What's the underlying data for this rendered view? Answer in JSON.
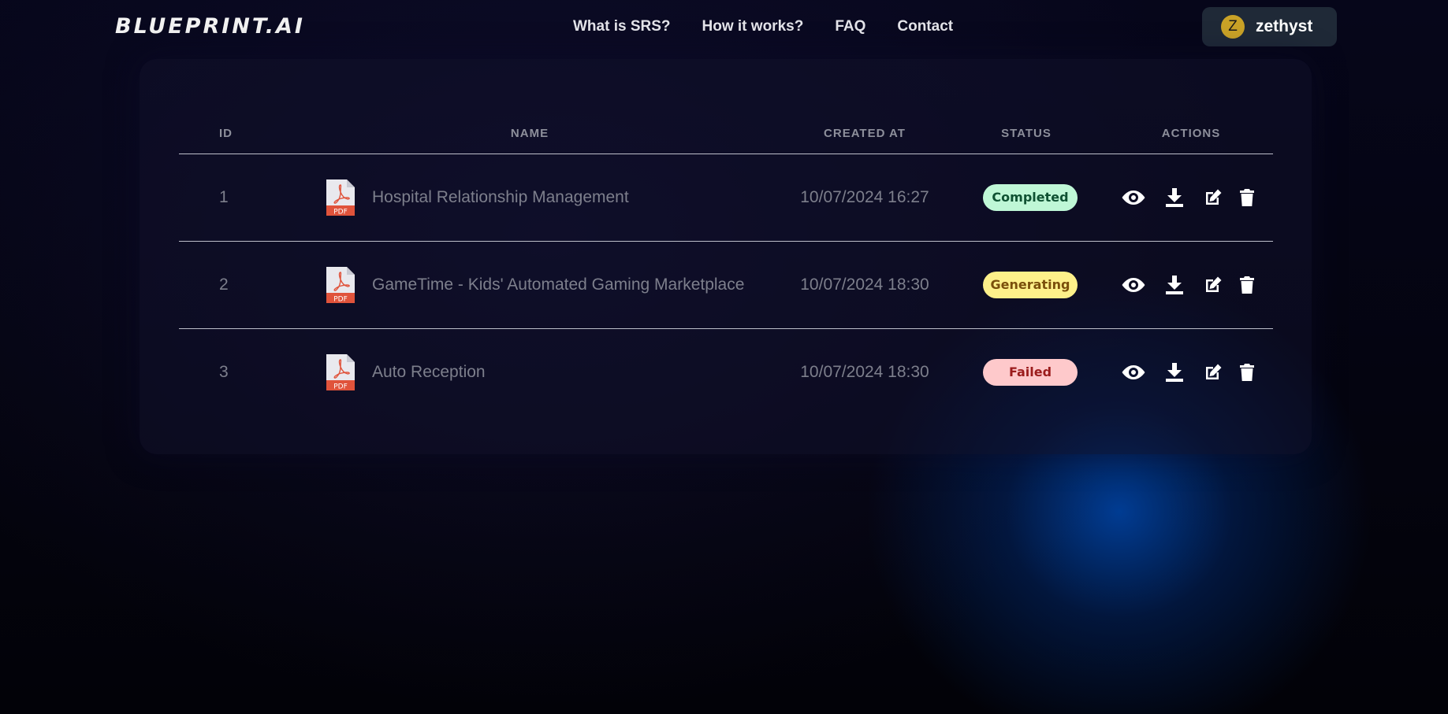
{
  "header": {
    "logo": "BLUEPRINT.AI",
    "nav": [
      {
        "label": "What is SRS?"
      },
      {
        "label": "How it works?"
      },
      {
        "label": "FAQ"
      },
      {
        "label": "Contact"
      }
    ],
    "user": {
      "initial": "Z",
      "name": "zethyst"
    }
  },
  "table": {
    "columns": {
      "id": "ID",
      "name": "NAME",
      "created_at": "CREATED AT",
      "status": "STATUS",
      "actions": "ACTIONS"
    },
    "rows": [
      {
        "id": "1",
        "name": "Hospital Relationship Management",
        "created_at": "10/07/2024 16:27",
        "status": "Completed"
      },
      {
        "id": "2",
        "name": "GameTime - Kids' Automated Gaming Marketplace",
        "created_at": "10/07/2024 18:30",
        "status": "Generating"
      },
      {
        "id": "3",
        "name": "Auto Reception",
        "created_at": "10/07/2024 18:30",
        "status": "Failed"
      }
    ],
    "file_icon_label": "PDF",
    "action_icons": [
      "eye-icon",
      "download-icon",
      "edit-icon",
      "trash-icon"
    ]
  },
  "colors": {
    "completed_bg": "#bff7d6",
    "generating_bg": "#fdf08a",
    "failed_bg": "#fec9cb",
    "accent_glow": "#0046aa",
    "user_chip_bg": "#1f2937"
  }
}
